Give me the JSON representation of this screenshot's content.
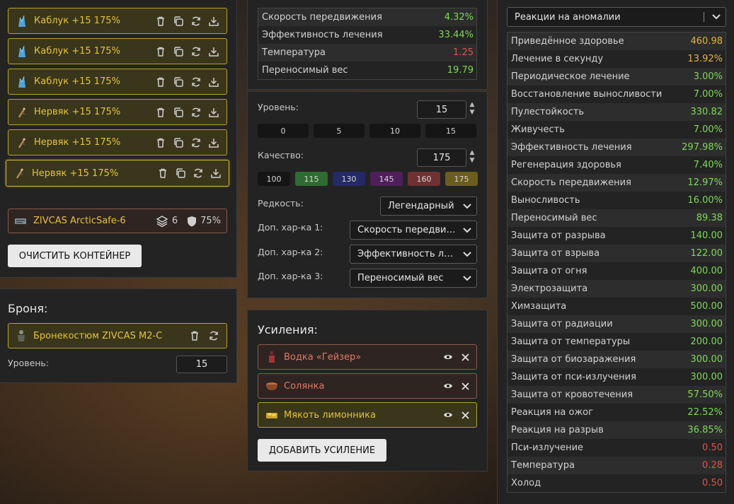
{
  "items": [
    {
      "name": "Каблук +15 175%",
      "icon": "crystal-icon"
    },
    {
      "name": "Каблук +15 175%",
      "icon": "crystal-icon"
    },
    {
      "name": "Каблук +15 175%",
      "icon": "crystal-icon"
    },
    {
      "name": "Нервяк +15 175%",
      "icon": "root-icon"
    },
    {
      "name": "Нервяк +15 175%",
      "icon": "root-icon"
    },
    {
      "name": "Нервяк +15 175%",
      "icon": "root-icon"
    }
  ],
  "container": {
    "name": "ZIVCAS ArcticSafe-6",
    "slots": "6",
    "protection": "75%",
    "clear_label": "ОЧИСТИТЬ КОНТЕЙНЕР"
  },
  "armor": {
    "title": "Броня:",
    "name": "Бронекостюм ZIVCAS M2-C",
    "level_label": "Уровень:",
    "level": "15"
  },
  "middle_stats": [
    {
      "name": "Скорость передвижения",
      "value": "4.32%",
      "color": "green"
    },
    {
      "name": "Эффективность лечения",
      "value": "33.44%",
      "color": "green"
    },
    {
      "name": "Температура",
      "value": "1.25",
      "color": "red"
    },
    {
      "name": "Переносимый вес",
      "value": "19.79",
      "color": "green"
    }
  ],
  "config": {
    "level_label": "Уровень:",
    "level": "15",
    "level_presets": [
      "0",
      "5",
      "10",
      "15"
    ],
    "quality_label": "Качество:",
    "quality": "175",
    "quality_presets": [
      {
        "label": "100",
        "color": "#151515"
      },
      {
        "label": "115",
        "color": "#2f6b32"
      },
      {
        "label": "130",
        "color": "#232a66"
      },
      {
        "label": "145",
        "color": "#4f1f5c"
      },
      {
        "label": "160",
        "color": "#6e3232"
      },
      {
        "label": "175",
        "color": "#6b5d1e"
      }
    ],
    "rarity_label": "Редкость:",
    "rarity": "Легендарный",
    "extra1_label": "Доп. хар-ка 1:",
    "extra1": "Скорость передвижения",
    "extra2_label": "Доп. хар-ка 2:",
    "extra2": "Эффективность лечения",
    "extra3_label": "Доп. хар-ка 3:",
    "extra3": "Переносимый вес"
  },
  "boosts": {
    "title": "Усиления:",
    "items": [
      {
        "name": "Водка «Гейзер»",
        "border": "#8a5a4a",
        "bg": "#2e2422",
        "icon": "bottle-icon"
      },
      {
        "name": "Солянка",
        "border": "#8a5a4a",
        "bg": "#2e2422",
        "icon": "bowl-icon"
      },
      {
        "name": "Мякоть лимонника",
        "border": "#b8a22a",
        "bg": "#39361c",
        "icon": "fruit-icon"
      }
    ],
    "add_label": "ДОБАВИТЬ УСИЛЕНИЕ"
  },
  "filter": {
    "selected": "Реакции на аномалии"
  },
  "right_stats": [
    {
      "name": "Приведённое здоровье",
      "value": "460.98",
      "color": "yellow"
    },
    {
      "name": "Лечение в секунду",
      "value": "13.92%",
      "color": "yellow"
    },
    {
      "name": "Периодическое лечение",
      "value": "3.00%",
      "color": "green"
    },
    {
      "name": "Восстановление выносливости",
      "value": "7.00%",
      "color": "green"
    },
    {
      "name": "Пулестойкость",
      "value": "330.82",
      "color": "green"
    },
    {
      "name": "Живучесть",
      "value": "7.00%",
      "color": "green"
    },
    {
      "name": "Эффективность лечения",
      "value": "297.98%",
      "color": "green"
    },
    {
      "name": "Регенерация здоровья",
      "value": "7.40%",
      "color": "green"
    },
    {
      "name": "Скорость передвижения",
      "value": "12.97%",
      "color": "green"
    },
    {
      "name": "Выносливость",
      "value": "16.00%",
      "color": "green"
    },
    {
      "name": "Переносимый вес",
      "value": "89.38",
      "color": "green"
    },
    {
      "name": "Защита от разрыва",
      "value": "140.00",
      "color": "green"
    },
    {
      "name": "Защита от взрыва",
      "value": "122.00",
      "color": "green"
    },
    {
      "name": "Защита от огня",
      "value": "400.00",
      "color": "green"
    },
    {
      "name": "Электрозащита",
      "value": "300.00",
      "color": "green"
    },
    {
      "name": "Химзащита",
      "value": "500.00",
      "color": "green"
    },
    {
      "name": "Защита от радиации",
      "value": "300.00",
      "color": "green"
    },
    {
      "name": "Защита от температуры",
      "value": "200.00",
      "color": "green"
    },
    {
      "name": "Защита от биозаражения",
      "value": "300.00",
      "color": "green"
    },
    {
      "name": "Защита от пси-излучения",
      "value": "300.00",
      "color": "green"
    },
    {
      "name": "Защита от кровотечения",
      "value": "57.50%",
      "color": "green"
    },
    {
      "name": "Реакция на ожог",
      "value": "22.52%",
      "color": "green"
    },
    {
      "name": "Реакция на разрыв",
      "value": "36.85%",
      "color": "green"
    },
    {
      "name": "Пси-излучение",
      "value": "0.50",
      "color": "red"
    },
    {
      "name": "Температура",
      "value": "0.28",
      "color": "red"
    },
    {
      "name": "Холод",
      "value": "0.50",
      "color": "red"
    }
  ]
}
